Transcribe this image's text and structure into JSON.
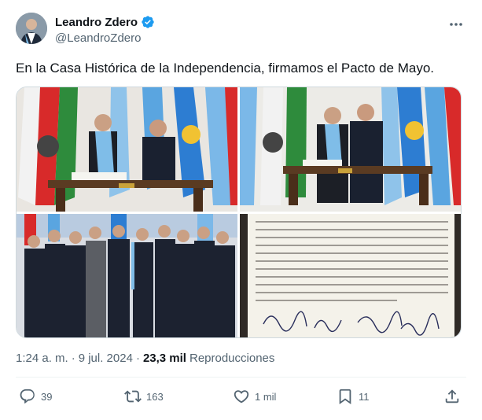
{
  "colors": {
    "verified": "#1d9bf0",
    "text": "#0f1419",
    "muted": "#536471"
  },
  "author": {
    "display_name": "Leandro Zdero",
    "handle": "@LeandroZdero",
    "verified_icon": "verified-badge-icon"
  },
  "tweet": {
    "text": "En la Casa Histórica de la Independencia, firmamos el Pacto de Mayo."
  },
  "meta": {
    "time": "1:24 a. m.",
    "separator": "·",
    "date": "9 jul. 2024",
    "views_count": "23,3 mil",
    "views_label": "Reproducciones"
  },
  "actions": {
    "replies": "39",
    "retweets": "163",
    "likes": "1 mil",
    "bookmarks": "11"
  }
}
